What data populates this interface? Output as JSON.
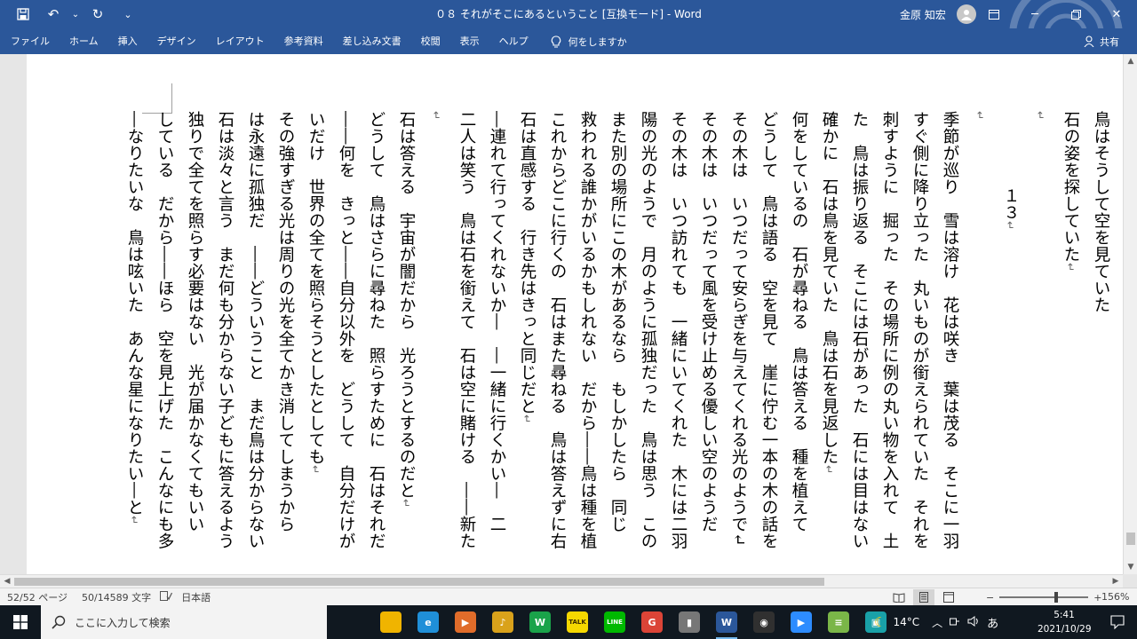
{
  "titlebar": {
    "title": "０８ それがそこにあるということ [互換モード] - Word",
    "user_name": "金原 知宏",
    "qat_more": "⌄"
  },
  "ribbon": {
    "tabs": [
      "ファイル",
      "ホーム",
      "挿入",
      "デザイン",
      "レイアウト",
      "参考資料",
      "差し込み文書",
      "校閲",
      "表示",
      "ヘルプ"
    ],
    "tell_me": "何をしますか",
    "share": "共有"
  },
  "document": {
    "columns": [
      {
        "text": "鳥はそうして空を見ていた"
      },
      {
        "text": "石の姿を探していた",
        "pmark": "↵"
      },
      {
        "text": "",
        "pmark": "↵"
      },
      {
        "text": "１３",
        "pmark": "↵",
        "heading": true
      },
      {
        "text": "",
        "pmark": "↵"
      },
      {
        "text": "季節が巡り　雪は溶け　花は咲き　葉は茂る　そこに一羽"
      },
      {
        "text": "すぐ側に降り立った　丸いものが銜えられていた　それを"
      },
      {
        "text": "刺すように　掘った　その場所に例の丸い物を入れて　土"
      },
      {
        "text": "た　鳥は振り返る　そこには石があった　石には目はない"
      },
      {
        "text": "確かに　石は鳥を見ていた　鳥は石を見返した",
        "pmark": "↵"
      },
      {
        "text": "何をしているの　石が尋ねる　鳥は答える　種を植えて"
      },
      {
        "text": "どうして　鳥は語る　空を見て　崖に佇む一本の木の話を"
      },
      {
        "text": "その木は　いつだって安らぎを与えてくれる光のようで↵"
      },
      {
        "text": "その木は　いつだって風を受け止める優しい空のようだ"
      },
      {
        "text": "その木は　いつ訪れても　一緒にいてくれた　木には二羽"
      },
      {
        "text": "陽の光のようで　月のように孤独だった　鳥は思う　この"
      },
      {
        "text": "また別の場所にこの木があるなら　もしかしたら　同じ"
      },
      {
        "text": "救われる誰かがいるかもしれない　だから――鳥は種を植"
      },
      {
        "text": "これからどこに行くの　石はまた尋ねる　鳥は答えずに右"
      },
      {
        "text": "石は直感する　行き先はきっと同じだと",
        "pmark": "↵"
      },
      {
        "text": "―連れて行ってくれないか―　―一緒に行くかい―　二"
      },
      {
        "text": "二人は笑う　鳥は石を銜えて　石は空に賭ける　――新た"
      },
      {
        "text": "",
        "pmark": "↵"
      },
      {
        "text": "石は答える　宇宙が闇だから　光ろうとするのだと",
        "pmark": "↵"
      },
      {
        "text": "どうして　鳥はさらに尋ねた　照らすために　石はそれだ"
      },
      {
        "text": "――何を　きっと――自分以外を　どうして　自分だけが"
      },
      {
        "text": "いだけ　世界の全てを照らそうとしたとしても",
        "pmark": "↵"
      },
      {
        "text": "その強すぎる光は周りの光を全てかき消してしまうから"
      },
      {
        "text": "は永遠に孤独だ　――どういうこと　まだ鳥は分からない"
      },
      {
        "text": "石は淡々と言う　まだ何も分からない子どもに答えるよう"
      },
      {
        "text": "独りで全てを照らす必要はない　光が届かなくてもいい"
      },
      {
        "text": "している　だから――ほら　空を見上げた　こんなにも多"
      },
      {
        "text": "―なりたいな　鳥は呟いた　あんな星になりたい―と",
        "pmark": "↵"
      }
    ]
  },
  "statusbar": {
    "page": "52/52 ページ",
    "words": "50/14589 文字",
    "language": "日本語",
    "zoom": "156%",
    "zoom_fraction": 0.64
  },
  "taskbar": {
    "search_placeholder": "ここに入力して検索",
    "apps": [
      {
        "name": "file-explorer",
        "color": "#f0b400",
        "label": ""
      },
      {
        "name": "edge",
        "color": "#1f8fd8",
        "label": "e"
      },
      {
        "name": "media-player",
        "color": "#e06c2a",
        "label": "▶"
      },
      {
        "name": "music",
        "color": "#d9a21b",
        "label": "♪"
      },
      {
        "name": "w-app",
        "color": "#1aa34a",
        "label": "W"
      },
      {
        "name": "talk",
        "color": "#f5d800",
        "label": "TALK"
      },
      {
        "name": "line",
        "color": "#00b900",
        "label": "LINE"
      },
      {
        "name": "chrome",
        "color": "#db4437",
        "label": "G"
      },
      {
        "name": "device",
        "color": "#777777",
        "label": "▮"
      },
      {
        "name": "word",
        "color": "#2b579a",
        "label": "W"
      },
      {
        "name": "obs",
        "color": "#303030",
        "label": "◉"
      },
      {
        "name": "zoom",
        "color": "#2d8cff",
        "label": "▶"
      },
      {
        "name": "stack",
        "color": "#7ab648",
        "label": "≡"
      },
      {
        "name": "capture",
        "color": "#19a1a8",
        "label": "▣"
      }
    ],
    "weather": "14°C",
    "ime": "あ",
    "time": "5:41",
    "date": "2021/10/29"
  },
  "colors": {
    "word_blue": "#2b579a",
    "taskbar": "#101820"
  }
}
